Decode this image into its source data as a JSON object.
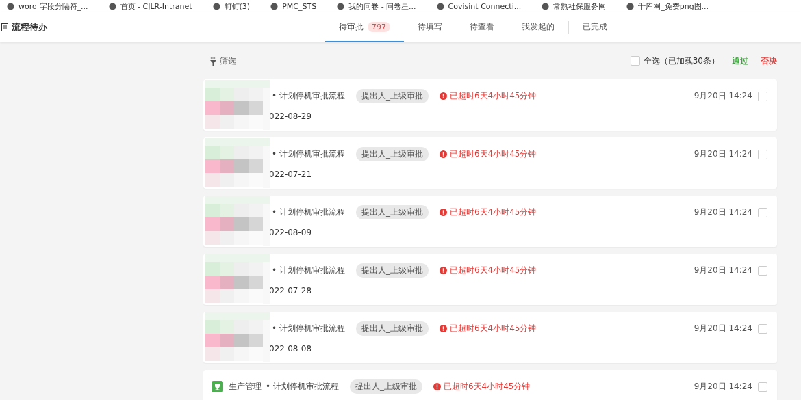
{
  "bookmarks": [
    "word 字段分隔符_...",
    "首页 - CJLR-Intranet",
    "钉钉(3)",
    "PMC_STS",
    "我的问卷 - 问卷星...",
    "Covisint Connecti...",
    "常熟社保服务网",
    "千库网_免费png图..."
  ],
  "header": {
    "title": "流程待办"
  },
  "tabs": [
    {
      "label": "待审批",
      "count": "797",
      "selected": true
    },
    {
      "label": "待填写",
      "selected": false
    },
    {
      "label": "待查看",
      "selected": false
    },
    {
      "label": "我发起的",
      "selected": false
    },
    {
      "label": "已完成",
      "selected": false
    }
  ],
  "toolbar": {
    "filter": "筛选",
    "select_all": {
      "label": "全选（已加载30条）",
      "checked": false
    },
    "approve": "通过",
    "reject": "否决"
  },
  "rows": [
    {
      "redacted": true,
      "process": "• 计划停机审批流程",
      "stage": "提出人_上级审批",
      "overdue": "已超时6天4小时45分钟",
      "time": "9月20日 14:24",
      "date": "022-08-29",
      "checked": false
    },
    {
      "redacted": true,
      "process": "• 计划停机审批流程",
      "stage": "提出人_上级审批",
      "overdue": "已超时6天4小时45分钟",
      "time": "9月20日 14:24",
      "date": "022-07-21",
      "checked": false
    },
    {
      "redacted": true,
      "process": "• 计划停机审批流程",
      "stage": "提出人_上级审批",
      "overdue": "已超时6天4小时45分钟",
      "time": "9月20日 14:24",
      "date": "022-08-09",
      "checked": false
    },
    {
      "redacted": true,
      "process": "• 计划停机审批流程",
      "stage": "提出人_上级审批",
      "overdue": "已超时6天4小时45分钟",
      "time": "9月20日 14:24",
      "date": "022-07-28",
      "checked": false
    },
    {
      "redacted": true,
      "process": "• 计划停机审批流程",
      "stage": "提出人_上级审批",
      "overdue": "已超时6天4小时45分钟",
      "time": "9月20日 14:24",
      "date": "022-08-08",
      "checked": false
    },
    {
      "redacted": false,
      "category": "生产管理",
      "process": "• 计划停机审批流程",
      "stage": "提出人_上级审批",
      "overdue": "已超时6天4小时45分钟",
      "time": "9月20日 14:24",
      "checked": false
    }
  ]
}
